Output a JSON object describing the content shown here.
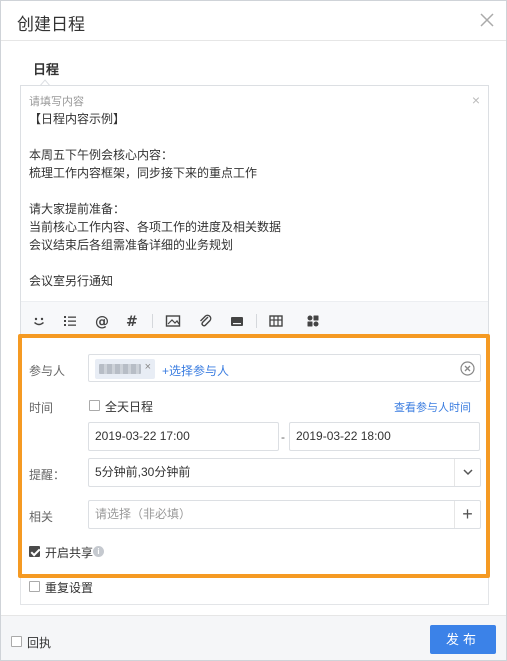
{
  "header": {
    "title": "创建日程"
  },
  "tab": {
    "label": "日程"
  },
  "editor": {
    "placeholder": "请填写内容",
    "lines": [
      "【日程内容示例】",
      "",
      "本周五下午例会核心内容：",
      "梳理工作内容框架，同步接下来的重点工作",
      "",
      "请大家提前准备：",
      "当前核心工作内容、各项工作的进度及相关数据",
      "会议结束后各组需准备详细的业务规划",
      "",
      "会议室另行通知"
    ],
    "toolbar_icons": [
      "emoji-icon",
      "list-icon",
      "mention-icon",
      "hashtag-icon",
      "image-icon",
      "attachment-icon",
      "template-icon",
      "table-icon",
      "apps-icon"
    ]
  },
  "participants": {
    "label": "参与人",
    "chip_remove": "×",
    "add_label": "+选择参与人"
  },
  "time": {
    "label": "时间",
    "all_day_label": "全天日程",
    "all_day_checked": false,
    "view_link": "查看参与人时间",
    "start": "2019-03-22 17:00",
    "separator": "-",
    "end": "2019-03-22 18:00"
  },
  "reminder": {
    "label": "提醒：",
    "value": "5分钟前,30分钟前"
  },
  "related": {
    "label": "相关",
    "placeholder": "请选择（非必填）",
    "add": "+"
  },
  "share": {
    "label": "开启共享",
    "checked": true,
    "info": "i"
  },
  "repeat": {
    "label": "重复设置",
    "checked": false
  },
  "footer": {
    "receipt_label": "回执",
    "receipt_checked": false,
    "publish_label": "发布"
  },
  "colors": {
    "highlight": "#f59a23",
    "primary": "#3b82e8",
    "link": "#3b7de0"
  }
}
